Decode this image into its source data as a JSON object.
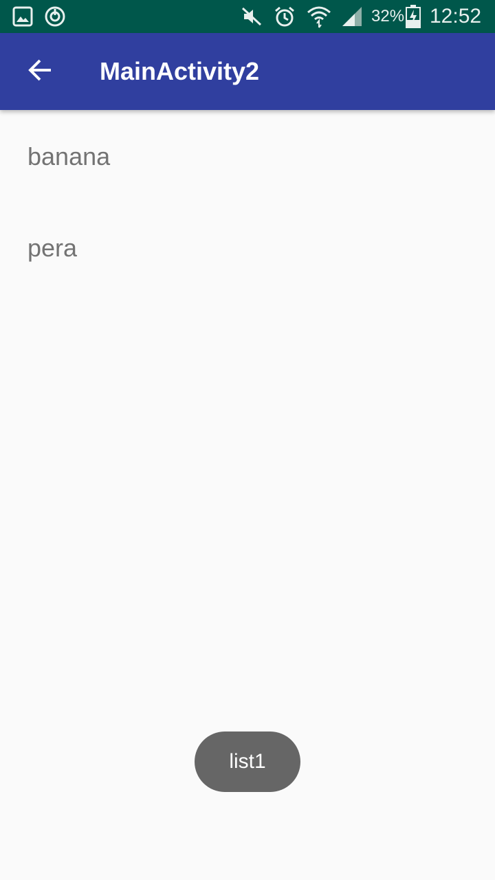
{
  "status_bar": {
    "left_icons": [
      "gallery-icon",
      "sync-icon"
    ],
    "right_icons": [
      "mute-icon",
      "alarm-icon",
      "wifi-icon",
      "signal-icon",
      "battery-charging-icon"
    ],
    "battery_percent": "32%",
    "time": "12:52",
    "background": "#00574b"
  },
  "app_bar": {
    "title": "MainActivity2",
    "back_icon": "arrow-back-icon",
    "background": "#303f9f"
  },
  "list": {
    "items": [
      {
        "label": "banana"
      },
      {
        "label": "pera"
      }
    ]
  },
  "toast": {
    "text": "list1"
  }
}
